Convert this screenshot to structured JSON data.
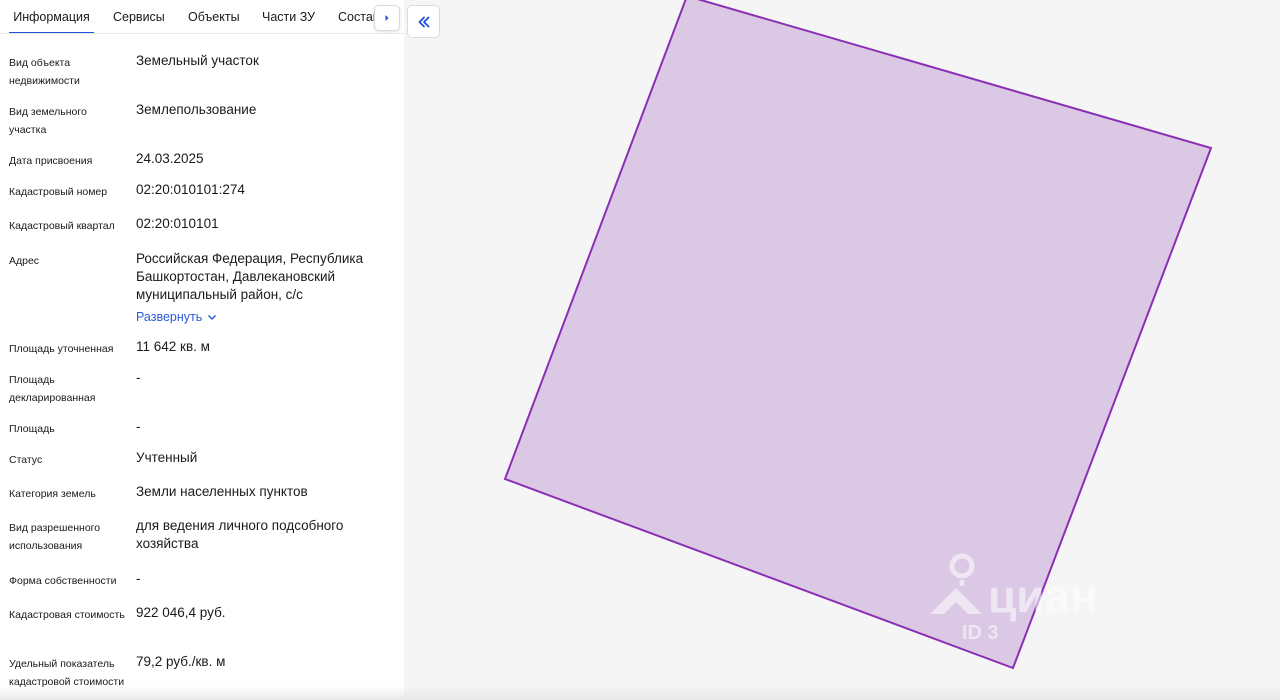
{
  "tabs": [
    {
      "label": "Информация",
      "active": true
    },
    {
      "label": "Сервисы",
      "active": false
    },
    {
      "label": "Объекты",
      "active": false
    },
    {
      "label": "Части ЗУ",
      "active": false
    },
    {
      "label": "Состав",
      "active": false
    }
  ],
  "fields": [
    {
      "label": "Вид объекта недвижимости",
      "value": "Земельный участок"
    },
    {
      "label": "Вид земельного участка",
      "value": "Землепользование"
    },
    {
      "label": "Дата присвоения",
      "value": "24.03.2025"
    },
    {
      "label": "Кадастровый номер",
      "value": "02:20:010101:274"
    },
    {
      "label": "Кадастровый квартал",
      "value": "02:20:010101"
    },
    {
      "label": "Адрес",
      "value": "Российская Федерация, Республика Башкортостан, Давлекановский муниципальный район, с/с"
    },
    {
      "label": "Площадь уточненная",
      "value": "11 642 кв. м"
    },
    {
      "label": "Площадь декларированная",
      "value": "-"
    },
    {
      "label": "Площадь",
      "value": "-"
    },
    {
      "label": "Статус",
      "value": "Учтенный"
    },
    {
      "label": "Категория земель",
      "value": "Земли населенных пунктов"
    },
    {
      "label": "Вид разрешенного использования",
      "value": "для ведения личного подсобного хозяйства"
    },
    {
      "label": "Форма собственности",
      "value": "-"
    },
    {
      "label": "Кадастровая стоимость",
      "value": "922 046,4 руб."
    },
    {
      "label": "Удельный показатель кадастровой стоимости",
      "value": "79,2 руб./кв. м"
    }
  ],
  "address_expand_label": "Развернуть",
  "watermark": {
    "brand": "циан",
    "sub": "ID 3"
  },
  "colors": {
    "accent": "#1e4fd8",
    "link": "#2a5bd7",
    "parcel_fill": "#dac8e4",
    "parcel_stroke": "#8a2fb4"
  },
  "icons": {
    "tab_scroll": "chevron-right-icon",
    "panel_collapse": "double-chevron-left-icon",
    "expand": "chevron-down-icon"
  }
}
